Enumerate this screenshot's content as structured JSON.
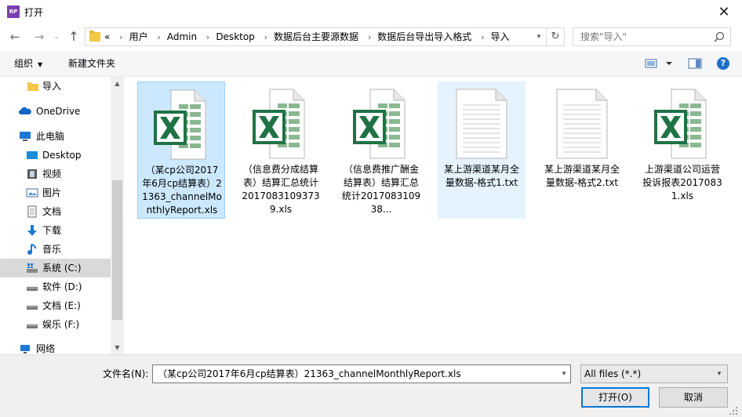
{
  "window": {
    "title": "打开",
    "app_icon_text": "RP",
    "close_label": "✕"
  },
  "nav": {
    "back_icon": "←",
    "forward_icon": "→",
    "recent_icon": "⌄",
    "up_icon": "↑",
    "breadcrumb_prefix": "«",
    "breadcrumbs": [
      "用户",
      "Admin",
      "Desktop",
      "数据后台主要源数据",
      "数据后台导出导入格式",
      "导入"
    ],
    "separator": "›",
    "refresh_icon": "↻",
    "search_placeholder": "搜索\"导入\""
  },
  "toolbar": {
    "organize_label": "组织",
    "organize_caret": "▼",
    "new_folder_label": "新建文件夹",
    "help_label": "?"
  },
  "sidebar": {
    "items": [
      {
        "label": "导入",
        "icon": "folder-icon",
        "indent": 1
      },
      {
        "label": "OneDrive",
        "icon": "cloud-icon",
        "indent": 0
      },
      {
        "label": "此电脑",
        "icon": "computer-icon",
        "indent": 0
      },
      {
        "label": "Desktop",
        "icon": "desktop-icon",
        "indent": 1
      },
      {
        "label": "视频",
        "icon": "video-icon",
        "indent": 1
      },
      {
        "label": "图片",
        "icon": "pictures-icon",
        "indent": 1
      },
      {
        "label": "文档",
        "icon": "documents-icon",
        "indent": 1
      },
      {
        "label": "下载",
        "icon": "download-icon",
        "indent": 1
      },
      {
        "label": "音乐",
        "icon": "music-icon",
        "indent": 1
      },
      {
        "label": "系统 (C:)",
        "icon": "system-drive-icon",
        "indent": 1,
        "selected": true
      },
      {
        "label": "软件 (D:)",
        "icon": "drive-icon",
        "indent": 1
      },
      {
        "label": "文档 (E:)",
        "icon": "drive-icon",
        "indent": 1
      },
      {
        "label": "娱乐 (F:)",
        "icon": "drive-icon",
        "indent": 1
      },
      {
        "label": "网络",
        "icon": "network-icon",
        "indent": 0
      }
    ]
  },
  "files": [
    {
      "name": "（某cp公司2017年6月cp结算表）21363_channelMonthlyReport.xls",
      "display": "（某cp公司2017年6月cp结算表）21363_channelMonthlyReport.xls",
      "type": "xls",
      "state": "selected"
    },
    {
      "name": "（信息费分成结算表）结算汇总统计20170831093739.xls",
      "display": "（信息费分成结算表）结算汇总统计20170831093739.xls",
      "type": "xls",
      "state": "normal"
    },
    {
      "name": "（信息费推广酬金结算表）结算汇总统计20170831093...",
      "display": "（信息费推广酬金结算表）结算汇总统计201708310938...",
      "type": "xls",
      "state": "normal"
    },
    {
      "name": "某上游渠道某月全量数据-格式1.txt",
      "display": "某上游渠道某月全量数据-格式1.txt",
      "type": "txt",
      "state": "hover"
    },
    {
      "name": "某上游渠道某月全量数据-格式2.txt",
      "display": "某上游渠道某月全量数据-格式2.txt",
      "type": "txt",
      "state": "normal"
    },
    {
      "name": "上游渠道公司运营投诉报表20170831.xls",
      "display": "上游渠道公司运营投诉报表20170831.xls",
      "type": "xls",
      "state": "normal"
    }
  ],
  "bottom": {
    "filename_label": "文件名(N):",
    "filename_value": "（某cp公司2017年6月cp结算表）21363_channelMonthlyReport.xls",
    "filetype_value": "All files (*.*)",
    "open_label": "打开(O)",
    "cancel_label": "取消"
  },
  "colors": {
    "excel_green": "#1f7244",
    "selection": "#cce8ff",
    "accent": "#0078d7"
  }
}
